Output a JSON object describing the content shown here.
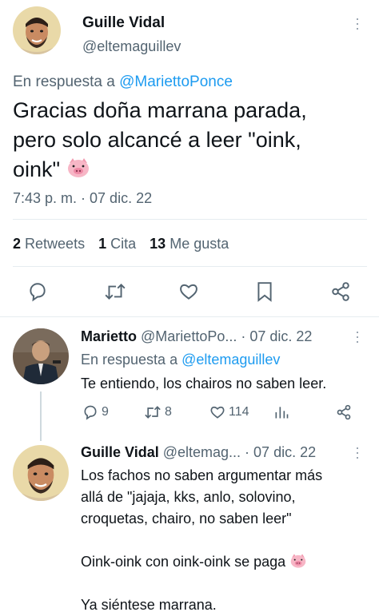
{
  "main_tweet": {
    "author_name": "Guille Vidal",
    "author_handle": "@eltemaguillev",
    "reply_prefix": "En respuesta a",
    "reply_to": "@MariettoPonce",
    "text_line1": "Gracias doña marrana parada,",
    "text_line2": "pero solo alcancé a leer \"oink,",
    "text_line3": "oink\"",
    "timestamp": "7:43 p. m. · 07 dic. 22",
    "stats": {
      "retweets_count": "2",
      "retweets_label": "Retweets",
      "quotes_count": "1",
      "quotes_label": "Cita",
      "likes_count": "13",
      "likes_label": "Me gusta"
    },
    "actions": [
      "reply-icon",
      "retweet-icon",
      "like-icon",
      "bookmark-icon",
      "share-icon"
    ]
  },
  "reply1": {
    "author_name": "Marietto",
    "author_handle": "@MariettoPo...",
    "date": "· 07 dic. 22",
    "reply_prefix": "En respuesta a",
    "reply_to": "@eltemaguillev",
    "text": "Te entiendo, los chairos no saben leer.",
    "reply_count": "9",
    "retweet_count": "8",
    "like_count": "114"
  },
  "reply2": {
    "author_name": "Guille Vidal",
    "author_handle": "@eltemag...",
    "date": "· 07 dic. 22",
    "text_line1": "Los fachos no saben argumentar más",
    "text_line2": "allá de \"jajaja, kks, anlo, solovino,",
    "text_line3": "croquetas, chairo, no saben leer\"",
    "text_line4": "Oink-oink con oink-oink se paga",
    "text_line5": "Ya siéntese marrana."
  },
  "colors": {
    "link": "#1d9bf0",
    "muted": "#536471",
    "text": "#0f1419",
    "divider": "#e6ecf0"
  }
}
